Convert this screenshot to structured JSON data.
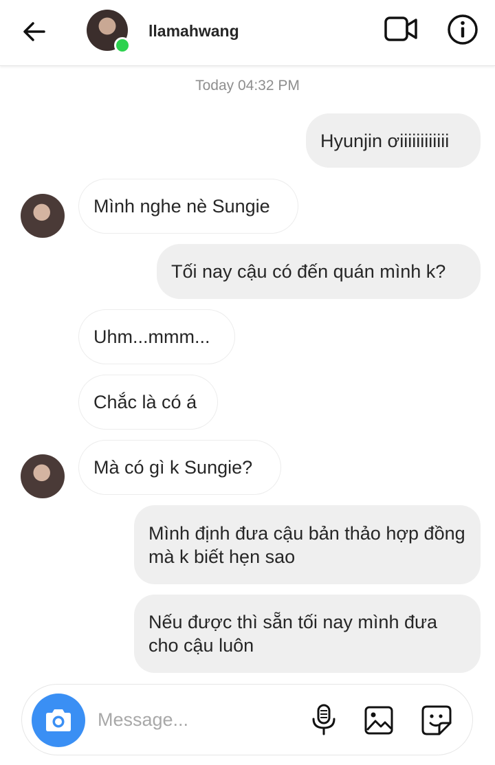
{
  "header": {
    "username": "llamahwang",
    "icons": {
      "back": "arrow-left-icon",
      "video": "video-camera-icon",
      "info": "info-icon"
    }
  },
  "conversation": {
    "timestamp": "Today 04:32 PM",
    "messages": [
      {
        "sender": "me",
        "text": "Hyunjin ơiiiiiiiiiiii"
      },
      {
        "sender": "llamahwang",
        "text": "Mình nghe nè Sungie"
      },
      {
        "sender": "me",
        "text": "Tối nay cậu có đến quán mình k?"
      },
      {
        "sender": "llamahwang",
        "text": "Uhm...mmm..."
      },
      {
        "sender": "llamahwang",
        "text": "Chắc là có á"
      },
      {
        "sender": "llamahwang",
        "text": "Mà có gì k Sungie?"
      },
      {
        "sender": "me",
        "text": "Mình định đưa cậu bản thảo hợp đồng mà k biết hẹn sao"
      },
      {
        "sender": "me",
        "text": "Nếu được thì sẵn tối nay mình đưa cho cậu luôn"
      }
    ]
  },
  "composer": {
    "placeholder": "Message...",
    "icons": {
      "camera": "camera-icon",
      "mic": "microphone-icon",
      "gallery": "image-icon",
      "sticker": "sticker-icon"
    }
  },
  "colors": {
    "accent": "#3a8ff4",
    "online": "#2dd24f",
    "outgoing_bubble": "#efefef",
    "timestamp": "#8e8e8e"
  }
}
